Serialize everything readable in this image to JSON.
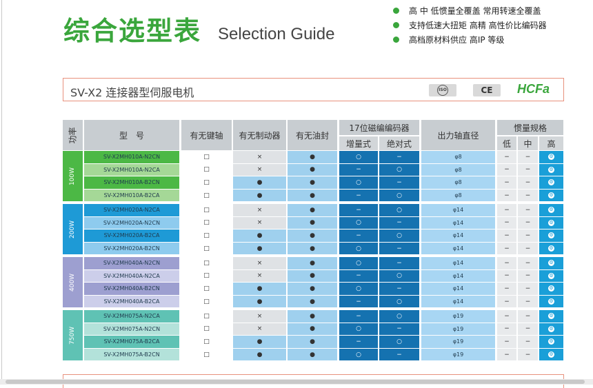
{
  "header": {
    "title_cn": "综合选型表",
    "title_en": "Selection Guide",
    "features": [
      "高 中 低惯量全覆盖 常用转速全覆盖",
      "支持低速大扭矩 高精 高性价比编码器",
      "高档原材料供应 高IP 等级"
    ]
  },
  "banner": {
    "title": "SV-X2 连接器型伺服电机",
    "logo_a": "ISO",
    "logo_b": "CE",
    "logo_c": "HCFa"
  },
  "table": {
    "headers": {
      "power": "功率",
      "model": "型　号",
      "keyway": "有无键轴",
      "brake": "有无制动器",
      "seal": "有无油封",
      "encoder": "17位磁编编码器",
      "incremental": "增量式",
      "absolute": "绝对式",
      "shaft": "出力轴直径",
      "inertia": "惯量规格",
      "low": "低",
      "mid": "中",
      "high": "高"
    },
    "groups": [
      {
        "power": "100W",
        "color": "#4cb845",
        "color_light": "#a5d897",
        "rows": [
          {
            "model": "SV-X2MH010A-N2CN",
            "keyway": "□",
            "brake": "×",
            "seal": "●",
            "inc": "○",
            "abs": "−",
            "shaft": "φ8",
            "low": "−",
            "mid": "−",
            "high": "⚙"
          },
          {
            "model": "SV-X2MH010A-N2CA",
            "keyway": "□",
            "brake": "×",
            "seal": "●",
            "inc": "−",
            "abs": "○",
            "shaft": "φ8",
            "low": "−",
            "mid": "−",
            "high": "⚙"
          },
          {
            "model": "SV-X2MH010A-B2CN",
            "keyway": "□",
            "brake": "●",
            "seal": "●",
            "inc": "○",
            "abs": "−",
            "shaft": "φ8",
            "low": "−",
            "mid": "−",
            "high": "⚙"
          },
          {
            "model": "SV-X2MH010A-B2CA",
            "keyway": "□",
            "brake": "●",
            "seal": "●",
            "inc": "−",
            "abs": "○",
            "shaft": "φ8",
            "low": "−",
            "mid": "−",
            "high": "⚙"
          }
        ]
      },
      {
        "power": "200W",
        "color": "#1e9ad6",
        "color_light": "#8ecbee",
        "rows": [
          {
            "model": "SV-X2MH020A-N2CA",
            "keyway": "□",
            "brake": "×",
            "seal": "●",
            "inc": "−",
            "abs": "○",
            "shaft": "φ14",
            "low": "−",
            "mid": "−",
            "high": "⚙"
          },
          {
            "model": "SV-X2MH020A-N2CN",
            "keyway": "□",
            "brake": "×",
            "seal": "●",
            "inc": "○",
            "abs": "−",
            "shaft": "φ14",
            "low": "−",
            "mid": "−",
            "high": "⚙"
          },
          {
            "model": "SV-X2MH020A-B2CA",
            "keyway": "□",
            "brake": "●",
            "seal": "●",
            "inc": "−",
            "abs": "○",
            "shaft": "φ14",
            "low": "−",
            "mid": "−",
            "high": "⚙"
          },
          {
            "model": "SV-X2MH020A-B2CN",
            "keyway": "□",
            "brake": "●",
            "seal": "●",
            "inc": "○",
            "abs": "−",
            "shaft": "φ14",
            "low": "−",
            "mid": "−",
            "high": "⚙"
          }
        ]
      },
      {
        "power": "400W",
        "color": "#9d9fd0",
        "color_light": "#ccceea",
        "rows": [
          {
            "model": "SV-X2MH040A-N2CN",
            "keyway": "□",
            "brake": "×",
            "seal": "●",
            "inc": "○",
            "abs": "−",
            "shaft": "φ14",
            "low": "−",
            "mid": "−",
            "high": "⚙"
          },
          {
            "model": "SV-X2MH040A-N2CA",
            "keyway": "□",
            "brake": "×",
            "seal": "●",
            "inc": "−",
            "abs": "○",
            "shaft": "φ14",
            "low": "−",
            "mid": "−",
            "high": "⚙"
          },
          {
            "model": "SV-X2MH040A-B2CN",
            "keyway": "□",
            "brake": "●",
            "seal": "●",
            "inc": "○",
            "abs": "−",
            "shaft": "φ14",
            "low": "−",
            "mid": "−",
            "high": "⚙"
          },
          {
            "model": "SV-X2MH040A-B2CA",
            "keyway": "□",
            "brake": "●",
            "seal": "●",
            "inc": "−",
            "abs": "○",
            "shaft": "φ14",
            "low": "−",
            "mid": "−",
            "high": "⚙"
          }
        ]
      },
      {
        "power": "750W",
        "color": "#5fc2b4",
        "color_light": "#b3e2da",
        "rows": [
          {
            "model": "SV-X2MH075A-N2CA",
            "keyway": "□",
            "brake": "×",
            "seal": "●",
            "inc": "−",
            "abs": "○",
            "shaft": "φ19",
            "low": "−",
            "mid": "−",
            "high": "⚙"
          },
          {
            "model": "SV-X2MH075A-N2CN",
            "keyway": "□",
            "brake": "×",
            "seal": "●",
            "inc": "○",
            "abs": "−",
            "shaft": "φ19",
            "low": "−",
            "mid": "−",
            "high": "⚙"
          },
          {
            "model": "SV-X2MH075A-B2CA",
            "keyway": "□",
            "brake": "●",
            "seal": "●",
            "inc": "−",
            "abs": "○",
            "shaft": "φ19",
            "low": "−",
            "mid": "−",
            "high": "⚙"
          },
          {
            "model": "SV-X2MH075A-B2CN",
            "keyway": "□",
            "brake": "●",
            "seal": "●",
            "inc": "○",
            "abs": "−",
            "shaft": "φ19",
            "low": "−",
            "mid": "−",
            "high": "⚙"
          }
        ]
      }
    ]
  }
}
